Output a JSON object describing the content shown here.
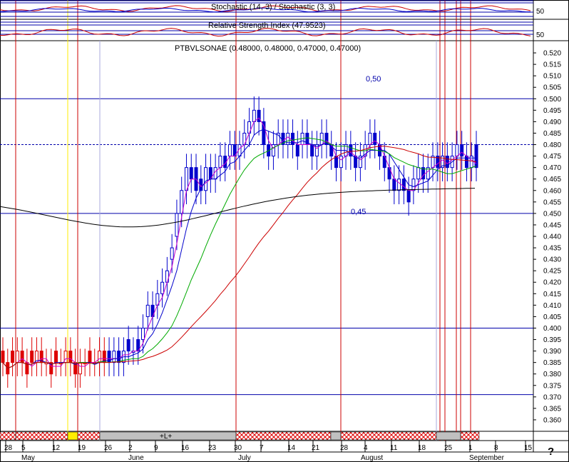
{
  "chart_data": [
    {
      "type": "line",
      "title": "Stochastic (14, 3) / Stochastic (3, 3)",
      "ylim": [
        0,
        100
      ],
      "y_ticks": [
        50
      ]
    },
    {
      "type": "line",
      "title": "Relative Strength Index (47.9523)",
      "ylim": [
        0,
        100
      ],
      "y_ticks": [
        50
      ]
    },
    {
      "type": "bar",
      "title": "PTBVLSONAE (0.48000, 0.48000, 0.47000, 0.47000)",
      "ylim": [
        0.355,
        0.525
      ],
      "y_ticks": [
        "0.520",
        "0.515",
        "0.510",
        "0.505",
        "0.500",
        "0.495",
        "0.490",
        "0.485",
        "0.480",
        "0.475",
        "0.470",
        "0.465",
        "0.460",
        "0.455",
        "0.450",
        "0.445",
        "0.440",
        "0.435",
        "0.430",
        "0.425",
        "0.420",
        "0.415",
        "0.410",
        "0.405",
        "0.400",
        "0.395",
        "0.390",
        "0.385",
        "0.380",
        "0.375",
        "0.370",
        "0.365",
        "0.360"
      ],
      "x_ticks": [
        "28",
        "5",
        "12",
        "19",
        "26",
        "2",
        "9",
        "16",
        "23",
        "30",
        "7",
        "14",
        "21",
        "28",
        "4",
        "11",
        "18",
        "25",
        "1",
        "8",
        "15"
      ],
      "x_months": [
        "May",
        "June",
        "July",
        "August",
        "September"
      ],
      "annotations": [
        "0,50",
        "0,45"
      ],
      "horizontal_levels": [
        0.5,
        0.48,
        0.45,
        0.4,
        0.371
      ],
      "strip_label": "+L+",
      "footer_mark": "?",
      "ohlc": [
        [
          0.39,
          0.385
        ],
        [
          0.385,
          0.38
        ],
        [
          0.39,
          0.385
        ],
        [
          0.385,
          0.39
        ],
        [
          0.39,
          0.385
        ],
        [
          0.385,
          0.38
        ],
        [
          0.39,
          0.385
        ],
        [
          0.385,
          0.39
        ],
        [
          0.39,
          0.385
        ],
        [
          0.385,
          0.385
        ],
        [
          0.385,
          0.38
        ],
        [
          0.39,
          0.385
        ],
        [
          0.385,
          0.385
        ],
        [
          0.385,
          0.39
        ],
        [
          0.39,
          0.385
        ],
        [
          0.385,
          0.38
        ],
        [
          0.38,
          0.385
        ],
        [
          0.385,
          0.385
        ],
        [
          0.39,
          0.385
        ],
        [
          0.385,
          0.385
        ],
        [
          0.385,
          0.39
        ],
        [
          0.39,
          0.385
        ],
        [
          0.39,
          0.385
        ],
        [
          0.385,
          0.39
        ],
        [
          0.39,
          0.385
        ],
        [
          0.385,
          0.39
        ],
        [
          0.395,
          0.39
        ],
        [
          0.39,
          0.39
        ],
        [
          0.395,
          0.39
        ],
        [
          0.395,
          0.4
        ],
        [
          0.405,
          0.41
        ],
        [
          0.41,
          0.405
        ],
        [
          0.41,
          0.415
        ],
        [
          0.415,
          0.42
        ],
        [
          0.42,
          0.425
        ],
        [
          0.43,
          0.435
        ],
        [
          0.44,
          0.45
        ],
        [
          0.45,
          0.46
        ],
        [
          0.46,
          0.47
        ],
        [
          0.47,
          0.465
        ],
        [
          0.47,
          0.46
        ],
        [
          0.465,
          0.46
        ],
        [
          0.46,
          0.47
        ],
        [
          0.47,
          0.465
        ],
        [
          0.465,
          0.47
        ],
        [
          0.47,
          0.475
        ],
        [
          0.475,
          0.47
        ],
        [
          0.475,
          0.48
        ],
        [
          0.48,
          0.475
        ],
        [
          0.475,
          0.48
        ],
        [
          0.48,
          0.485
        ],
        [
          0.485,
          0.49
        ],
        [
          0.49,
          0.495
        ],
        [
          0.495,
          0.49
        ],
        [
          0.49,
          0.48
        ],
        [
          0.48,
          0.475
        ],
        [
          0.475,
          0.48
        ],
        [
          0.48,
          0.485
        ],
        [
          0.485,
          0.48
        ],
        [
          0.48,
          0.485
        ],
        [
          0.485,
          0.48
        ],
        [
          0.48,
          0.475
        ],
        [
          0.48,
          0.485
        ],
        [
          0.485,
          0.48
        ],
        [
          0.48,
          0.475
        ],
        [
          0.475,
          0.48
        ],
        [
          0.48,
          0.485
        ],
        [
          0.485,
          0.48
        ],
        [
          0.48,
          0.475
        ],
        [
          0.475,
          0.47
        ],
        [
          0.47,
          0.475
        ],
        [
          0.475,
          0.48
        ],
        [
          0.48,
          0.475
        ],
        [
          0.475,
          0.47
        ],
        [
          0.47,
          0.475
        ],
        [
          0.475,
          0.48
        ],
        [
          0.48,
          0.485
        ],
        [
          0.485,
          0.48
        ],
        [
          0.48,
          0.475
        ],
        [
          0.475,
          0.47
        ],
        [
          0.47,
          0.465
        ],
        [
          0.465,
          0.46
        ],
        [
          0.46,
          0.465
        ],
        [
          0.465,
          0.46
        ],
        [
          0.46,
          0.455
        ],
        [
          0.46,
          0.465
        ],
        [
          0.465,
          0.47
        ],
        [
          0.47,
          0.465
        ],
        [
          0.465,
          0.47
        ],
        [
          0.47,
          0.475
        ],
        [
          0.475,
          0.47
        ],
        [
          0.47,
          0.475
        ],
        [
          0.475,
          0.47
        ],
        [
          0.47,
          0.475
        ],
        [
          0.475,
          0.48
        ],
        [
          0.48,
          0.475
        ],
        [
          0.475,
          0.47
        ],
        [
          0.47,
          0.475
        ],
        [
          0.48,
          0.47
        ]
      ]
    }
  ]
}
